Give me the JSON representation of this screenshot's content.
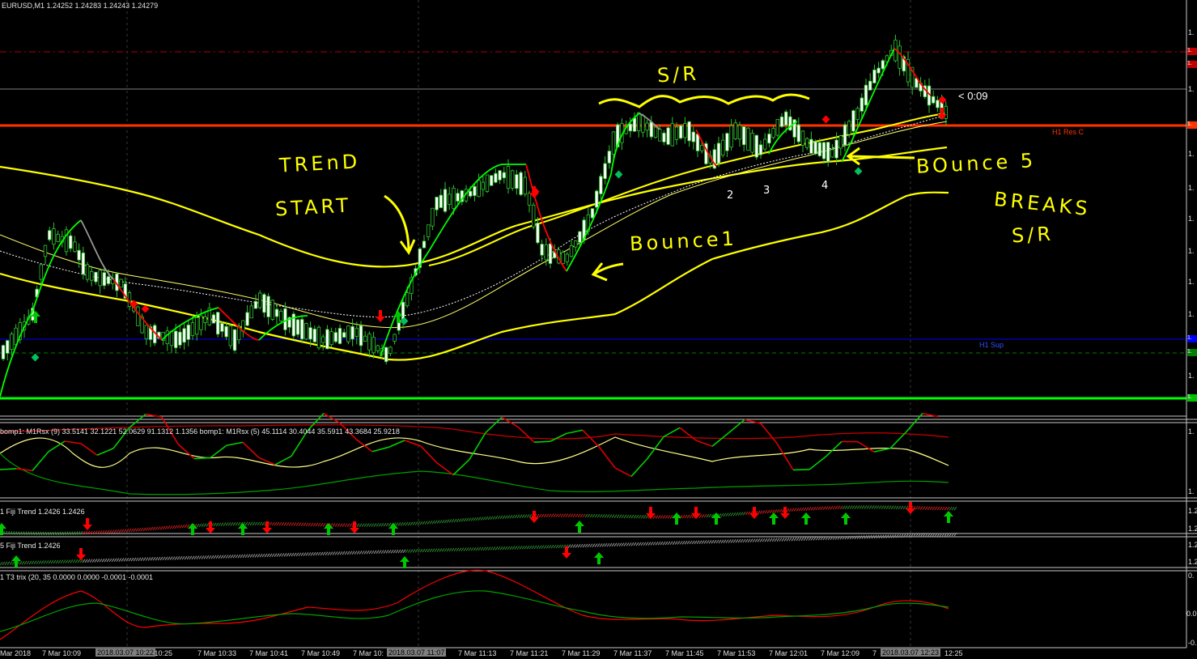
{
  "header": {
    "symbol_info": "EURUSD,M1  1.24252 1.24283 1.24243 1.24279"
  },
  "timer": "< 0:09",
  "levels": {
    "res_label": "H1 Res C",
    "sup_label": "H1 Sup"
  },
  "price_axis": {
    "tick_text": "1.",
    "tag_text": "1."
  },
  "panes": {
    "rsx_title": "bomp1: M1Rsx (9) 33.5141 32.1221 52.0629 91.1312 1.1356  bomp1: M1Rsx (5) 45.1114 30.4044 35.5911 43.3684 25.9218",
    "fiji1_title": "1 Fiji Trend 1.2426 1.2426",
    "fiji5_title": "5 Fiji Trend 1.2426",
    "trix_title": "1 T3 trix (20, 35 0.0000 0.0000 -0.0001 -0.0001",
    "fiji_axis": "1.2",
    "trix_axis_top": "0.",
    "trix_axis_mid": "0.0",
    "trix_axis_bot": "-0."
  },
  "annotations": {
    "trend": "TREnD",
    "start": "START",
    "sr": "S/R",
    "bounce1": "Bounce1",
    "bounce5": "BOunce 5",
    "breaks": "BREAKS",
    "breaks_sr": "S/R",
    "n2": "2",
    "n3": "3",
    "n4": "4"
  },
  "time_axis": {
    "labels": [
      "Mar 2018",
      "7 Mar 10:09",
      "ar 10:25",
      "7 Mar 10:33",
      "7 Mar 10:41",
      "7 Mar 10:49",
      "7 Mar 10:",
      "7 Mar 11:13",
      "7 Mar 11:21",
      "7 Mar 11:29",
      "7 Mar 11:37",
      "7 Mar 11:45",
      "7 Mar 11:53",
      "7 Mar 12:01",
      "7 Mar 12:09",
      "7",
      "12:25"
    ],
    "highlights": [
      "2018.03.07 10:22",
      "2018.03.07 11:07",
      "2018.03.07 12:23"
    ]
  },
  "colors": {
    "background": "#000000",
    "bull_candle": "#ffffff",
    "envelope": "#ffff00",
    "resistance": "#ff3300",
    "support_blue": "#0000ff",
    "support_green": "#00ff00",
    "up_arrow": "#00c800",
    "down_arrow": "#ff0000"
  }
}
